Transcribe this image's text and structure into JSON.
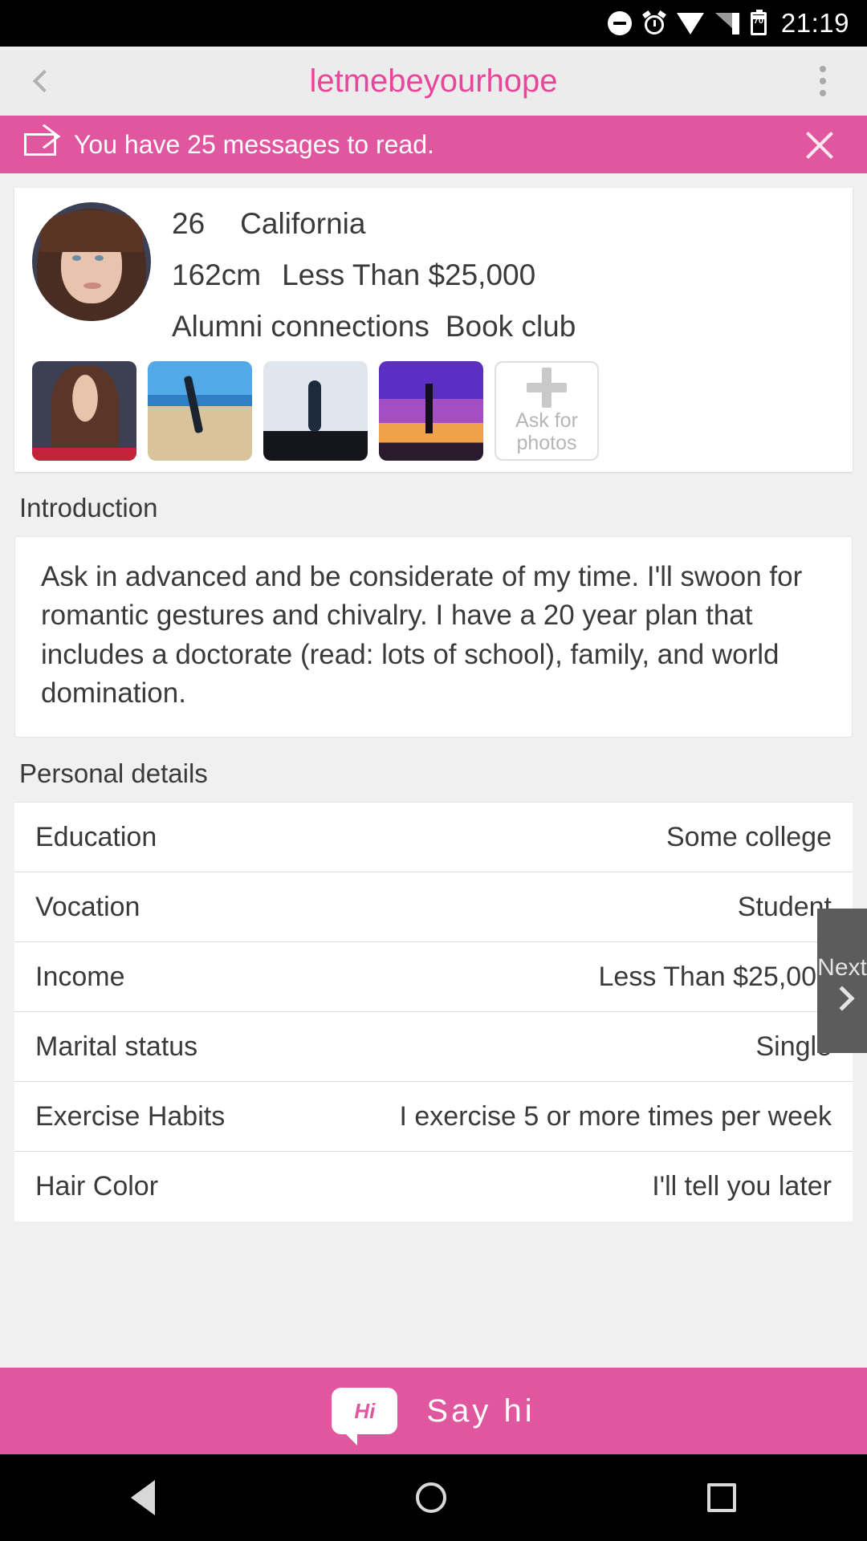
{
  "status_bar": {
    "icons": [
      "do-not-disturb-icon",
      "alarm-icon",
      "wifi-icon",
      "signal-icon",
      "battery-icon"
    ],
    "battery_level": "70",
    "time": "21:19"
  },
  "app_bar": {
    "back_label": "",
    "title": "letmebeyourhope",
    "overflow_label": ""
  },
  "banner": {
    "icon": "envelope-icon",
    "text": "You have 25 messages to read.",
    "close_label": "",
    "color": "#e0579f"
  },
  "profile": {
    "age": "26",
    "location": "California",
    "height": "162cm",
    "income": "Less Than $25,000",
    "interest_1": "Alumni connections",
    "interest_2": "Book club",
    "photos_count": 4,
    "ask_for_photos_line1": "Ask for",
    "ask_for_photos_line2": "photos"
  },
  "introduction": {
    "heading": "Introduction",
    "body": "Ask in advanced and be considerate of my time. I'll swoon for romantic gestures and chivalry. I have a 20 year plan that includes a doctorate (read: lots of school), family, and world domination."
  },
  "personal_details": {
    "heading": "Personal details",
    "rows": [
      {
        "label": "Education",
        "value": "Some college"
      },
      {
        "label": "Vocation",
        "value": "Student"
      },
      {
        "label": "Income",
        "value": "Less Than $25,000"
      },
      {
        "label": "Marital status",
        "value": "Single"
      },
      {
        "label": "Exercise Habits",
        "value": "I exercise 5 or more times per week"
      },
      {
        "label": "Hair Color",
        "value": "I'll tell you later"
      }
    ]
  },
  "next_button": {
    "label": "Next",
    "icon": "chevron-right-icon"
  },
  "say_hi": {
    "icon_text": "Hi",
    "label": "Say hi",
    "color": "#e0579f"
  },
  "nav_bar": {
    "back": "back-triangle-icon",
    "home": "home-circle-icon",
    "recents": "recents-square-icon"
  }
}
